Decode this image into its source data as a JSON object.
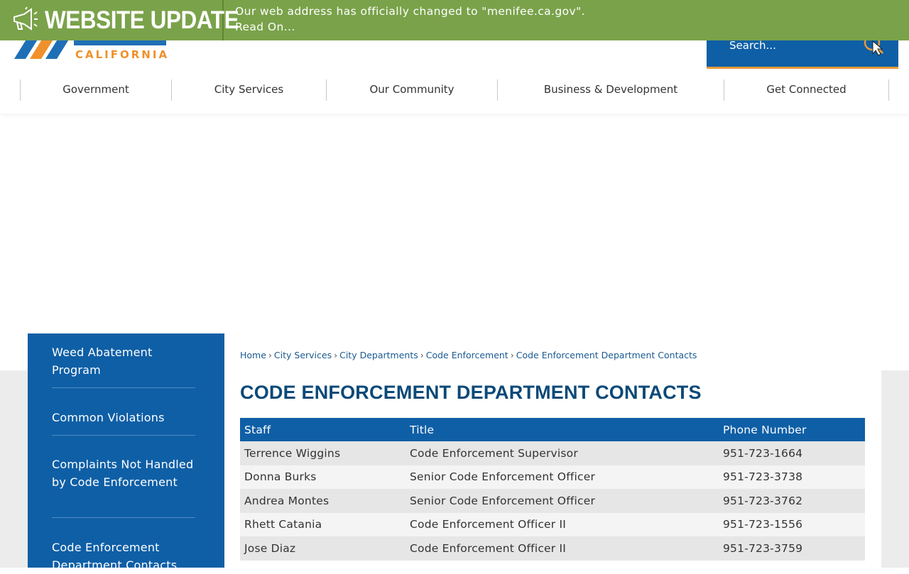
{
  "banner": {
    "title": "WEBSITE UPDATE",
    "message_line1": "Our web address has officially changed to \"menifee.ca.gov\".",
    "message_line2": "Read On..."
  },
  "logo": {
    "subtitle": "CALIFORNIA"
  },
  "search": {
    "placeholder": "Search..."
  },
  "nav": [
    {
      "label": "Government"
    },
    {
      "label": "City Services"
    },
    {
      "label": "Our Community"
    },
    {
      "label": "Business & Development"
    },
    {
      "label": "Get Connected"
    }
  ],
  "sidebar": {
    "items": [
      {
        "label": "Weed Abatement Program"
      },
      {
        "label": "Common Violations"
      },
      {
        "label": "Complaints Not Handled by Code Enforcement"
      },
      {
        "label": "Code Enforcement Department Contacts"
      }
    ]
  },
  "breadcrumb": [
    {
      "label": "Home"
    },
    {
      "label": "City Services"
    },
    {
      "label": "City Departments"
    },
    {
      "label": "Code Enforcement"
    },
    {
      "label": "Code Enforcement Department Contacts"
    }
  ],
  "breadcrumb_separator": "›",
  "page": {
    "title": "CODE ENFORCEMENT DEPARTMENT CONTACTS"
  },
  "table": {
    "headers": [
      "Staff",
      "Title",
      "Phone Number"
    ],
    "rows": [
      [
        "Terrence Wiggins",
        "Code Enforcement Supervisor",
        "951-723-1664"
      ],
      [
        "Donna Burks",
        "Senior Code Enforcement Officer",
        "951-723-3738"
      ],
      [
        "Andrea Montes",
        "Senior Code Enforcement Officer",
        "951-723-3762"
      ],
      [
        "Rhett Catania",
        "Code Enforcement Officer II",
        "951-723-1556"
      ],
      [
        "Jose Diaz",
        "Code Enforcement Officer II",
        "951-723-3759"
      ]
    ]
  },
  "colors": {
    "banner_green": "#7aa24a",
    "brand_blue": "#0e5fa5",
    "title_blue": "#0b4a78",
    "accent_orange": "#f0902a"
  },
  "icons": {
    "banner": "megaphone-icon",
    "search": "search-icon"
  }
}
